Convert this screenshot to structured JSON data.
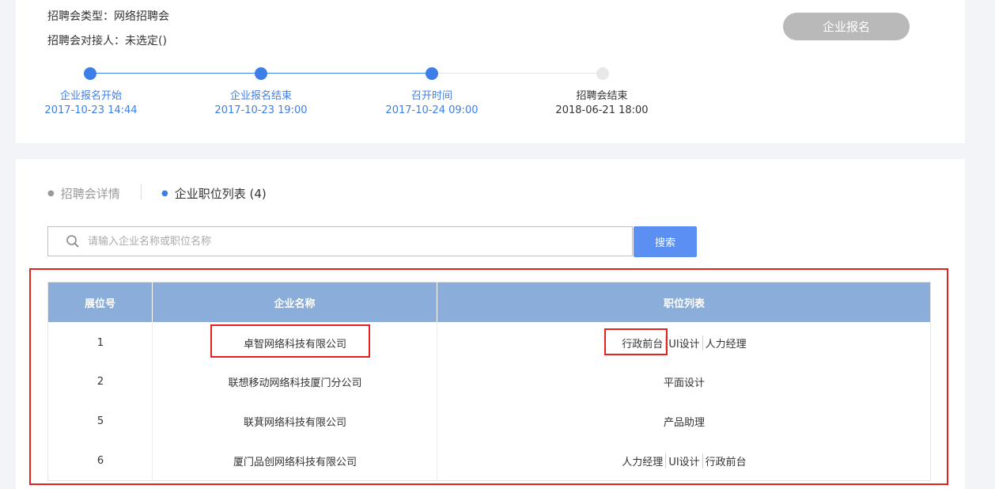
{
  "fair_info": {
    "type_label": "招聘会类型：",
    "type_value": "网络招聘会",
    "contact_label": "招聘会对接人：",
    "contact_value": "未选定()"
  },
  "register_button": "企业报名",
  "timeline": [
    {
      "label": "企业报名开始",
      "time": "2017-10-23 14:44"
    },
    {
      "label": "企业报名结束",
      "time": "2017-10-23 19:00"
    },
    {
      "label": "召开时间",
      "time": "2017-10-24 09:00"
    },
    {
      "label": "招聘会结束",
      "time": "2018-06-21 18:00"
    }
  ],
  "tabs": {
    "details": "招聘会详情",
    "positions": "企业职位列表 (4)"
  },
  "search": {
    "placeholder": "请输入企业名称或职位名称",
    "button": "搜索"
  },
  "table": {
    "headers": [
      "展位号",
      "企业名称",
      "职位列表"
    ],
    "rows": [
      {
        "booth": "1",
        "company": "卓智网络科技有限公司",
        "jobs": [
          "行政前台",
          "UI设计",
          "人力经理"
        ]
      },
      {
        "booth": "2",
        "company": "联想移动网络科技厦门分公司",
        "jobs": [
          "平面设计"
        ]
      },
      {
        "booth": "5",
        "company": "联萁网络科技有限公司",
        "jobs": [
          "产品助理"
        ]
      },
      {
        "booth": "6",
        "company": "厦门品创网络科技有限公司",
        "jobs": [
          "人力经理",
          "UI设计",
          "行政前台"
        ]
      }
    ]
  },
  "colors": {
    "accent": "#3d7fe8",
    "header_bg": "#8aaed9",
    "search_button": "#5b8ff2",
    "register_disabled": "#b9b9b9",
    "highlight": "#e3231f"
  }
}
